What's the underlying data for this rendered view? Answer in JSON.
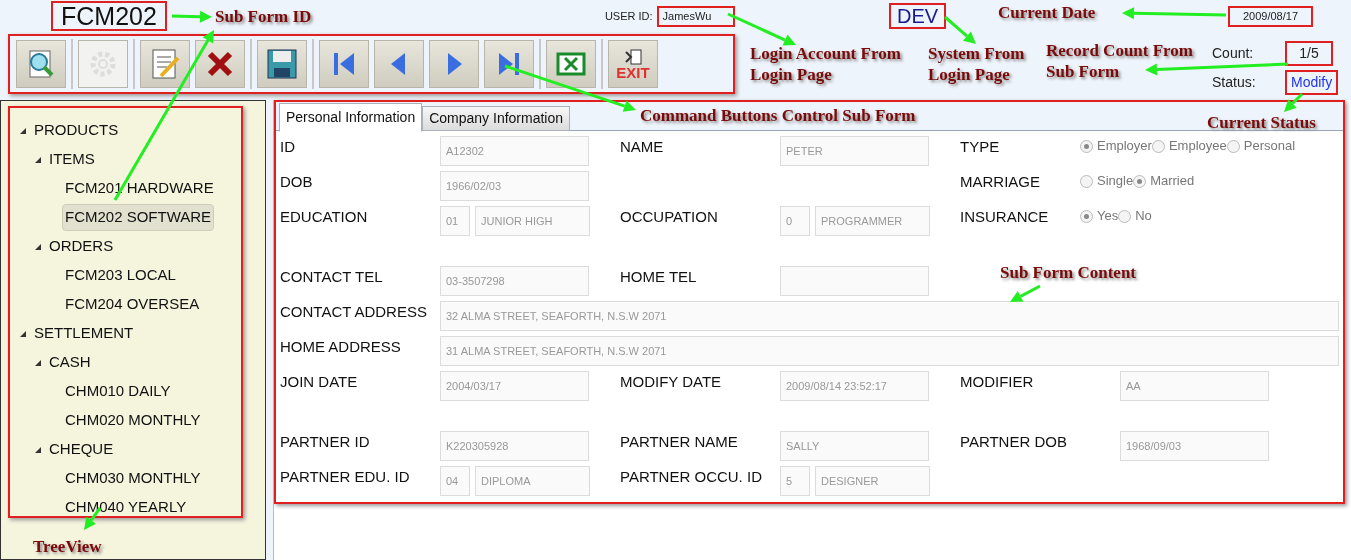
{
  "header": {
    "form_id": "FCM202",
    "user_id_label": "USER ID:",
    "user_id": "JamesWu",
    "system": "DEV",
    "date": "2009/08/17",
    "count_label": "Count:",
    "count": "1/5",
    "status_label": "Status:",
    "status": "Modify"
  },
  "toolbar": [
    {
      "kind": "search",
      "disabled": false
    },
    {
      "kind": "settings",
      "disabled": true
    },
    {
      "kind": "edit",
      "disabled": false
    },
    {
      "kind": "delete",
      "disabled": false
    },
    {
      "kind": "save",
      "disabled": false
    },
    {
      "kind": "first",
      "disabled": false
    },
    {
      "kind": "previous",
      "disabled": false
    },
    {
      "kind": "next",
      "disabled": false
    },
    {
      "kind": "last",
      "disabled": false
    },
    {
      "kind": "excel",
      "disabled": false
    },
    {
      "kind": "exit",
      "disabled": false,
      "label": "EXIT"
    }
  ],
  "tree": [
    {
      "label": "PRODUCTS",
      "expanded": true,
      "selected": false,
      "children": [
        {
          "label": "ITEMS",
          "expanded": true,
          "selected": false,
          "children": [
            {
              "label": "FCM201 HARDWARE",
              "selected": false
            },
            {
              "label": "FCM202 SOFTWARE",
              "selected": true
            }
          ]
        },
        {
          "label": "ORDERS",
          "expanded": true,
          "selected": false,
          "children": [
            {
              "label": "FCM203 LOCAL",
              "selected": false
            },
            {
              "label": "FCM204 OVERSEA",
              "selected": false
            }
          ]
        }
      ]
    },
    {
      "label": "SETTLEMENT",
      "expanded": true,
      "selected": false,
      "children": [
        {
          "label": "CASH",
          "expanded": true,
          "selected": false,
          "children": [
            {
              "label": "CHM010 DAILY",
              "selected": false
            },
            {
              "label": "CHM020 MONTHLY",
              "selected": false
            }
          ]
        },
        {
          "label": "CHEQUE",
          "expanded": true,
          "selected": false,
          "children": [
            {
              "label": "CHM030 MONTHLY",
              "selected": false
            },
            {
              "label": "CHM040 YEARLY",
              "selected": false
            }
          ]
        }
      ]
    }
  ],
  "tabs": [
    {
      "label": "Personal Information",
      "selected": true
    },
    {
      "label": "Company Information",
      "selected": false
    }
  ],
  "form": {
    "sections": [
      [
        [
          {
            "kind": "text",
            "label": "ID",
            "value": "A12302"
          },
          {
            "kind": "text",
            "label": "NAME",
            "value": "PETER"
          },
          {
            "kind": "radio",
            "label": "TYPE",
            "options": [
              {
                "label": "Employer",
                "selected": true
              },
              {
                "label": "Employee",
                "selected": false
              },
              {
                "label": "Personal",
                "selected": false
              }
            ]
          }
        ],
        [
          {
            "kind": "text",
            "label": "DOB",
            "value": "1966/02/03"
          },
          {
            "kind": "empty"
          },
          {
            "kind": "radio",
            "label": "MARRIAGE",
            "options": [
              {
                "label": "Single",
                "selected": false
              },
              {
                "label": "Married",
                "selected": true
              }
            ]
          }
        ],
        [
          {
            "kind": "code",
            "label": "EDUCATION",
            "code": "01",
            "value": "JUNIOR HIGH"
          },
          {
            "kind": "code",
            "label": "OCCUPATION",
            "code": "0",
            "value": "PROGRAMMER"
          },
          {
            "kind": "radio",
            "label": "INSURANCE",
            "options": [
              {
                "label": "Yes",
                "selected": true
              },
              {
                "label": "No",
                "selected": false
              }
            ]
          }
        ]
      ],
      [
        [
          {
            "kind": "text",
            "label": "CONTACT TEL",
            "value": "03-3507298"
          },
          {
            "kind": "text",
            "label": "HOME TEL"
          }
        ],
        [
          {
            "kind": "wide",
            "label": "CONTACT ADDRESS",
            "value": "32 ALMA STREET, SEAFORTH, N.S.W 2071"
          }
        ],
        [
          {
            "kind": "wide",
            "label": "HOME ADDRESS",
            "value": "31 ALMA STREET, SEAFORTH, N.S.W 2071"
          }
        ],
        [
          {
            "kind": "text",
            "label": "JOIN DATE",
            "value": "2004/03/17"
          },
          {
            "kind": "text",
            "label": "MODIFY DATE",
            "value": "2009/08/14 23:52:17"
          },
          {
            "kind": "text",
            "label": "MODIFIER",
            "value": "AA"
          }
        ]
      ],
      [
        [
          {
            "kind": "text",
            "label": "PARTNER ID",
            "value": "K220305928"
          },
          {
            "kind": "text",
            "label": "PARTNER NAME",
            "value": "SALLY"
          },
          {
            "kind": "text",
            "label": "PARTNER DOB",
            "value": "1968/09/03"
          }
        ],
        [
          {
            "kind": "code",
            "label": "PARTNER EDU. ID",
            "code": "04",
            "value": "DIPLOMA"
          },
          {
            "kind": "code",
            "label": "PARTNER OCCU. ID",
            "code": "5",
            "value": "DESIGNER"
          }
        ]
      ]
    ]
  },
  "annotations": [
    {
      "text": "Sub Form ID"
    },
    {
      "text": "Login Account From Login Page"
    },
    {
      "text": "System From Login Page"
    },
    {
      "text": "Current Date"
    },
    {
      "text": "Record Count From Sub Form"
    },
    {
      "text": "Command Buttons Control Sub Form"
    },
    {
      "text": "Current Status"
    },
    {
      "text": "Sub Form Content"
    },
    {
      "text": "TreeView"
    }
  ]
}
